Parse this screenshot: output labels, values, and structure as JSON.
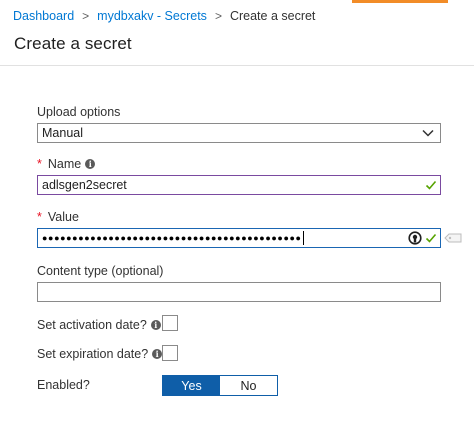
{
  "breadcrumb": {
    "items": [
      "Dashboard",
      "mydbxakv - Secrets"
    ],
    "separator": ">",
    "current": "Create a secret"
  },
  "header": {
    "title": "Create a secret"
  },
  "form": {
    "upload_options": {
      "label": "Upload options",
      "value": "Manual"
    },
    "name": {
      "required": "*",
      "label": "Name",
      "value": "adlsgen2secret"
    },
    "value": {
      "required": "*",
      "label": "Value",
      "masked_value": "●●●●●●●●●●●●●●●●●●●●●●●●●●●●●●●●●●●●●●●●●●●"
    },
    "content_type": {
      "label": "Content type (optional)",
      "value": ""
    },
    "activation": {
      "label": "Set activation date?",
      "checked": false
    },
    "expiration": {
      "label": "Set expiration date?",
      "checked": false
    },
    "enabled": {
      "label": "Enabled?",
      "options": [
        "Yes",
        "No"
      ],
      "selected": "Yes"
    }
  },
  "colors": {
    "accent": "#f28c28",
    "link": "#0078d4",
    "primary": "#0f5ea8",
    "required": "#e81123",
    "valid": "#57a300"
  },
  "icons": {
    "info": "info-icon",
    "chevron": "chevron-down-icon",
    "check": "check-icon",
    "reveal": "eye-reveal-icon",
    "key_hint": "key-hint-icon"
  }
}
